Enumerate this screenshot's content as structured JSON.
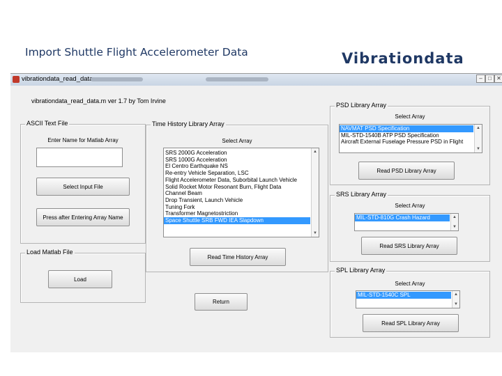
{
  "slide": {
    "title": "Import Shuttle Flight Accelerometer Data",
    "brand": "Vibrationdata"
  },
  "window": {
    "title": "vibrationdata_read_data",
    "header": "vibrationdata_read_data.m  ver 1.7    by Tom Irvine",
    "controls": [
      "–",
      "□",
      "✕"
    ]
  },
  "ascii_panel": {
    "title": "ASCII Text File",
    "enter_label": "Enter Name for Matlab Array",
    "name_value": "",
    "select_button": "Select Input File",
    "press_button": "Press after Entering Array Name"
  },
  "load_panel": {
    "title": "Load Matlab File",
    "load_button": "Load"
  },
  "time_history_panel": {
    "title": "Time History Library Array",
    "select_label": "Select Array",
    "items": [
      "SRS 2000G Acceleration",
      "SRS 1000G Acceleration",
      "El Centro Earthquake NS",
      "Re-entry Vehicle Separation, LSC",
      "Flight Accelerometer Data, Suborbital Launch Vehicle",
      "Solid Rocket Motor Resonant Burn, Flight Data",
      "Channel Beam",
      "Drop Transient, Launch Vehicle",
      "Tuning Fork",
      "Transformer Magnetostriction",
      "Space Shuttle SRB FWD IEA Slapdown"
    ],
    "selected_index": 10,
    "read_button": "Read Time History Array"
  },
  "return_button": "Return",
  "psd_panel": {
    "title": "PSD Library Array",
    "select_label": "Select Array",
    "items": [
      "NAVMAT PSD Specification",
      "MIL-STD-1540B ATP PSD Specification",
      "Aircraft External Fuselage Pressure PSD in Flight"
    ],
    "selected_index": 0,
    "read_button": "Read PSD Library Array"
  },
  "srs_panel": {
    "title": "SRS Library Array",
    "select_label": "Select Array",
    "items": [
      "MIL-STD-810G Crash Hazard"
    ],
    "selected_index": 0,
    "read_button": "Read SRS Library Array"
  },
  "spl_panel": {
    "title": "SPL Library Array",
    "select_label": "Select Array",
    "items": [
      "MIL-STD-1540C SPL"
    ],
    "selected_index": 0,
    "read_button": "Read SPL Library Array"
  }
}
